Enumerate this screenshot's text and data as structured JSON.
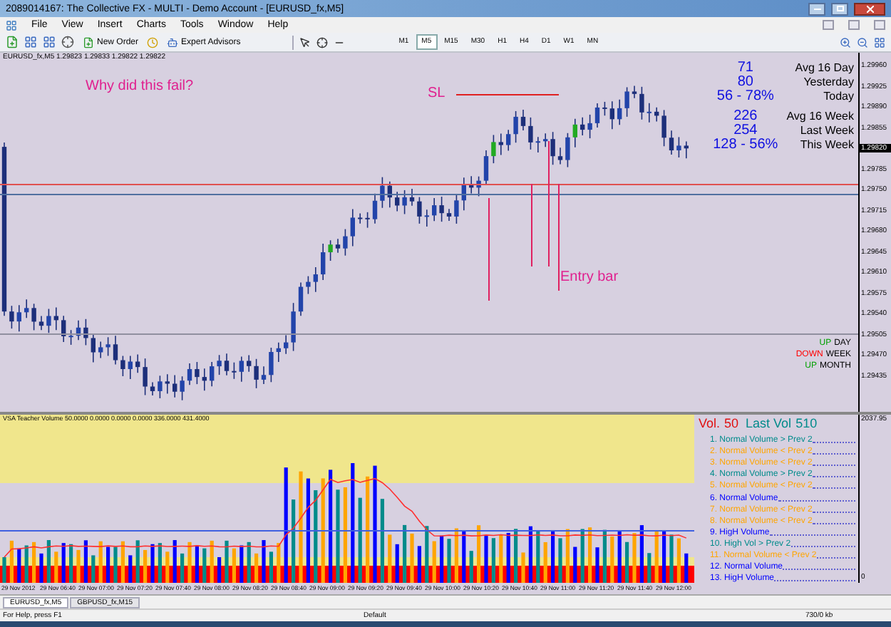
{
  "window": {
    "title": "2089014167: The Collective FX - MULTI - Demo Account - [EURUSD_fx,M5]"
  },
  "menu": [
    "File",
    "View",
    "Insert",
    "Charts",
    "Tools",
    "Window",
    "Help"
  ],
  "toolbar": {
    "buttons": [
      "New Order",
      "Expert Advisors"
    ],
    "timeframes": [
      {
        "label": "M1",
        "selected": false
      },
      {
        "label": "M5",
        "selected": true
      },
      {
        "label": "M15",
        "selected": false
      },
      {
        "label": "M30",
        "selected": false
      },
      {
        "label": "H1",
        "selected": false
      },
      {
        "label": "H4",
        "selected": false
      },
      {
        "label": "D1",
        "selected": false
      },
      {
        "label": "W1",
        "selected": false
      },
      {
        "label": "MN",
        "selected": false
      }
    ]
  },
  "chart": {
    "header": "EURUSD_fx,M5  1.29823 1.29833 1.29822 1.29822",
    "annotations": [
      "Why did this fail?",
      "SL",
      "Entry bar"
    ],
    "stats": [
      {
        "value": "71",
        "label": "Avg 16 Day"
      },
      {
        "value": "80",
        "label": "Yesterday"
      },
      {
        "value": "56 - 78%",
        "label": "Today"
      },
      {
        "value": "226",
        "label": "Avg 16 Week"
      },
      {
        "value": "254",
        "label": "Last Week"
      },
      {
        "value": "128 - 56%",
        "label": "This Week"
      }
    ],
    "trend": [
      {
        "direction": "UP",
        "period": "DAY",
        "color": "#00a000"
      },
      {
        "direction": "DOWN",
        "period": "WEEK",
        "color": "#ff0000"
      },
      {
        "direction": "UP",
        "period": "MONTH",
        "color": "#00a000"
      }
    ],
    "price_axis": [
      {
        "label": "1.29960",
        "highlighted": false
      },
      {
        "label": "1.29925",
        "highlighted": false
      },
      {
        "label": "1.29890",
        "highlighted": false
      },
      {
        "label": "1.29855",
        "highlighted": false
      },
      {
        "label": "1.29820",
        "highlighted": true
      },
      {
        "label": "1.29785",
        "highlighted": false
      },
      {
        "label": "1.29750",
        "highlighted": false
      },
      {
        "label": "1.29715",
        "highlighted": false
      },
      {
        "label": "1.29680",
        "highlighted": false
      },
      {
        "label": "1.29645",
        "highlighted": false
      },
      {
        "label": "1.29610",
        "highlighted": false
      },
      {
        "label": "1.29575",
        "highlighted": false
      },
      {
        "label": "1.29540",
        "highlighted": false
      },
      {
        "label": "1.29505",
        "highlighted": false
      },
      {
        "label": "1.29470",
        "highlighted": false
      },
      {
        "label": "1.29435",
        "highlighted": false
      }
    ]
  },
  "volume": {
    "header": "VSA Teacher Volume 50.0000 0.0000 0.0000 0.0000 336.0000 431.4000",
    "vol_label": "Vol.",
    "vol_value": "50",
    "last_label": "Last Vol",
    "last_value": "510",
    "axis": [
      "2037.95",
      "0"
    ],
    "legend": [
      {
        "text": "1. Normal Volume > Prev 2",
        "color": "#008b8b"
      },
      {
        "text": "2. Normal Volume < Prev 2",
        "color": "#ffa500"
      },
      {
        "text": "3. Normal Volume < Prev 2",
        "color": "#ffa500"
      },
      {
        "text": "4. Normal Volume > Prev 2",
        "color": "#008b8b"
      },
      {
        "text": "5. Normal Volume < Prev 2",
        "color": "#ffa500"
      },
      {
        "text": "6. Normal Volume",
        "color": "#0000ff"
      },
      {
        "text": "7. Normal Volume < Prev 2",
        "color": "#ffa500"
      },
      {
        "text": "8. Normal Volume < Prev 2",
        "color": "#ffa500"
      },
      {
        "text": "9. HigH Volume",
        "color": "#0000ff"
      },
      {
        "text": "10. High Vol > Prev 2",
        "color": "#008b8b"
      },
      {
        "text": "11. Normal Volume < Prev 2",
        "color": "#ffa500"
      },
      {
        "text": "12. Normal Volume",
        "color": "#0000ff"
      },
      {
        "text": "13. HigH Volume",
        "color": "#0000ff"
      }
    ]
  },
  "time_axis": [
    "29 Nov 2012",
    "29 Nov 06:40",
    "29 Nov 07:00",
    "29 Nov 07:20",
    "29 Nov 07:40",
    "29 Nov 08:00",
    "29 Nov 08:20",
    "29 Nov 08:40",
    "29 Nov 09:00",
    "29 Nov 09:20",
    "29 Nov 09:40",
    "29 Nov 10:00",
    "29 Nov 10:20",
    "29 Nov 10:40",
    "29 Nov 11:00",
    "29 Nov 11:20",
    "29 Nov 11:40",
    "29 Nov 12:00"
  ],
  "tabs": [
    {
      "label": "EURUSD_fx,M5",
      "selected": true
    },
    {
      "label": "GBPUSD_fx,M15",
      "selected": false
    }
  ],
  "status_bar": {
    "help": "For Help, press F1",
    "profile": "Default",
    "traffic": "730/0 kb"
  }
}
